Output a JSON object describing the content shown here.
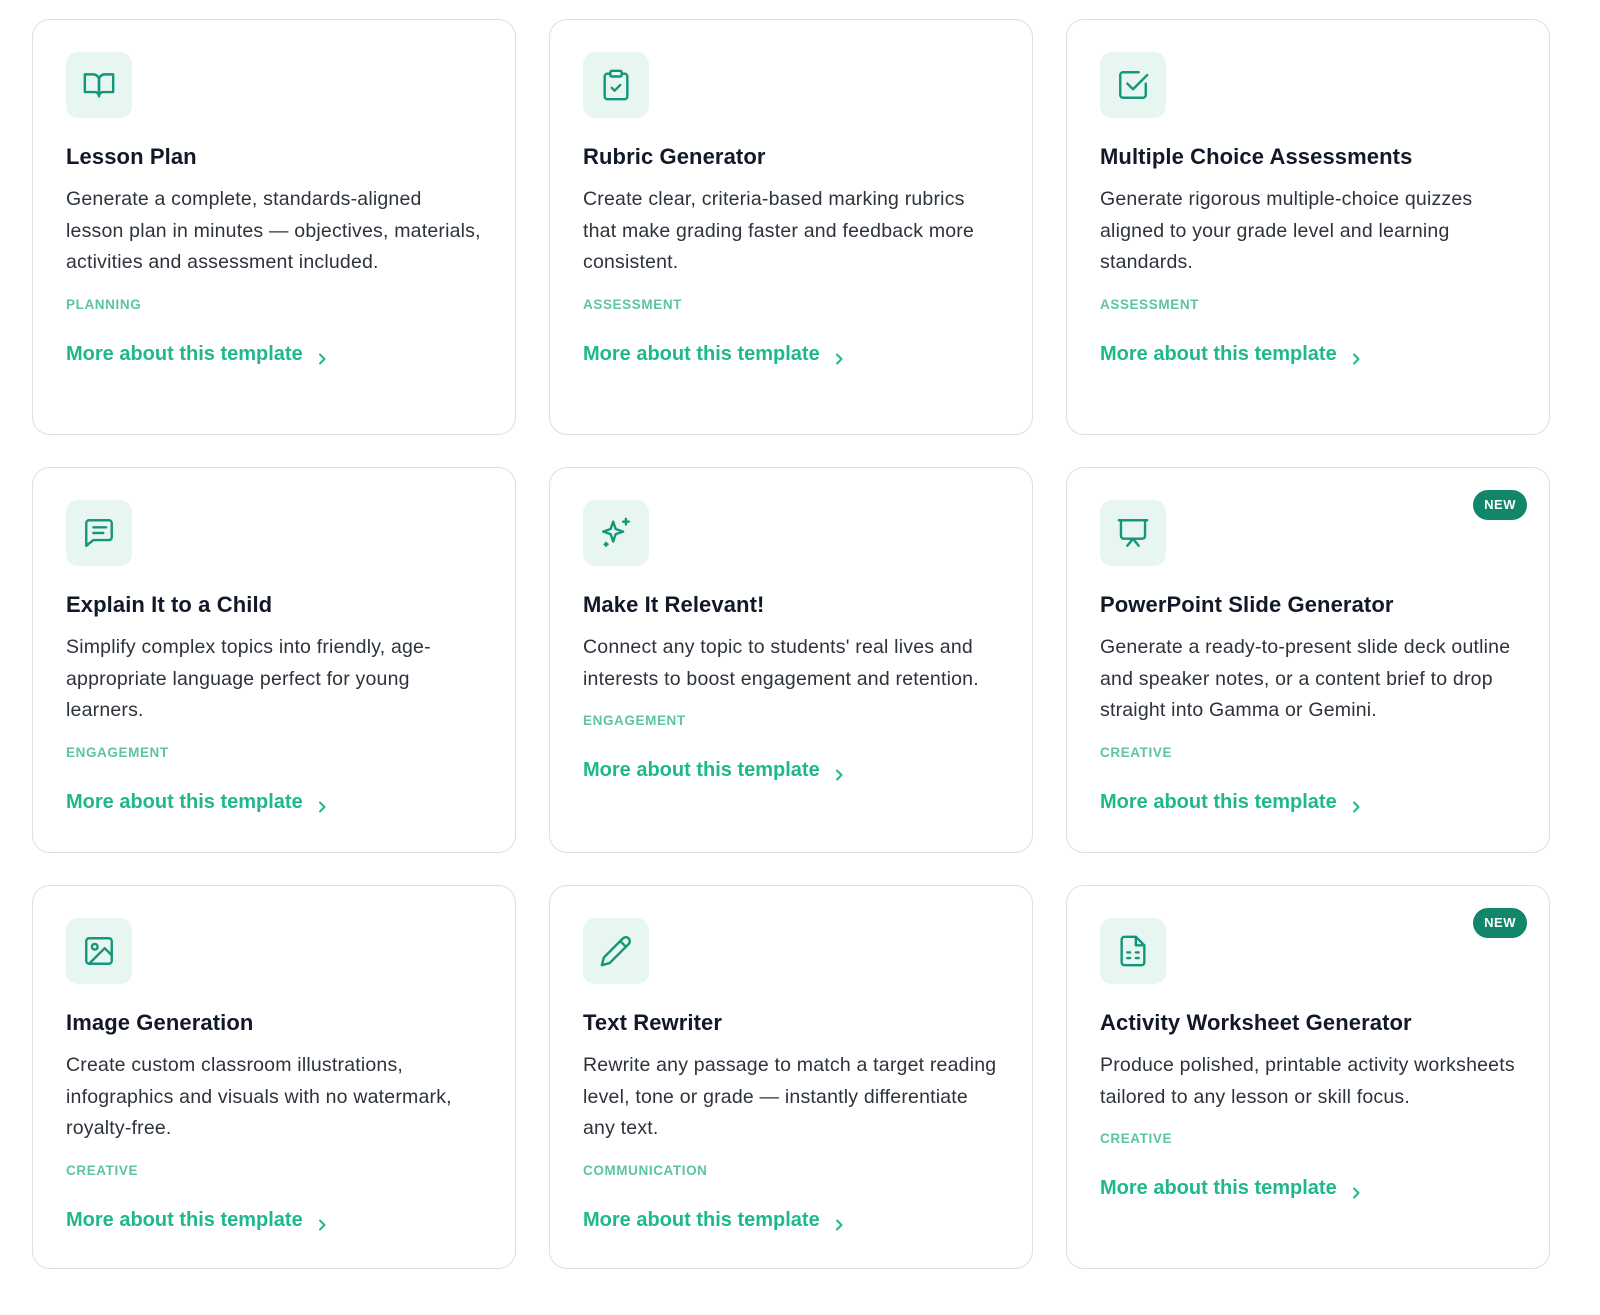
{
  "colors": {
    "accent": "#1fb88d",
    "category": "#5cc4a4",
    "icon_bg": "#e8f6f1",
    "icon_stroke": "#14967a",
    "badge_bg": "#11866b",
    "card_border": "#dcdfe3"
  },
  "cards": [
    {
      "icon": "book-open-icon",
      "title": "Lesson Plan",
      "description": "Generate a complete, standards-aligned lesson plan in minutes — objectives, materials, activities and assessment included.",
      "category": "PLANNING",
      "link_label": "More about this template",
      "badge": ""
    },
    {
      "icon": "clipboard-check-icon",
      "title": "Rubric Generator",
      "description": "Create clear, criteria-based marking rubrics that make grading faster and feedback more consistent.",
      "category": "ASSESSMENT",
      "link_label": "More about this template",
      "badge": ""
    },
    {
      "icon": "square-check-icon",
      "title": "Multiple Choice Assessments",
      "description": "Generate rigorous multiple-choice quizzes aligned to your grade level and learning standards.",
      "category": "ASSESSMENT",
      "link_label": "More about this template",
      "badge": ""
    },
    {
      "icon": "message-text-icon",
      "title": "Explain It to a Child",
      "description": "Simplify complex topics into friendly, age-appropriate language perfect for young learners.",
      "category": "ENGAGEMENT",
      "link_label": "More about this template",
      "badge": ""
    },
    {
      "icon": "sparkles-icon",
      "title": "Make It Relevant!",
      "description": "Connect any topic to students' real lives and interests to boost engagement and retention.",
      "category": "ENGAGEMENT",
      "link_label": "More about this template",
      "badge": ""
    },
    {
      "icon": "presentation-icon",
      "title": "PowerPoint Slide Generator",
      "description": "Generate a ready-to-present slide deck outline and speaker notes, or a content brief to drop straight into Gamma or Gemini.",
      "category": "CREATIVE",
      "link_label": "More about this template",
      "badge": "NEW"
    },
    {
      "icon": "image-icon",
      "title": "Image Generation",
      "description": "Create custom classroom illustrations, infographics and visuals with no watermark, royalty-free.",
      "category": "CREATIVE",
      "link_label": "More about this template",
      "badge": ""
    },
    {
      "icon": "pencil-icon",
      "title": "Text Rewriter",
      "description": "Rewrite any passage to match a target reading level, tone or grade — instantly differentiate any text.",
      "category": "COMMUNICATION",
      "link_label": "More about this template",
      "badge": ""
    },
    {
      "icon": "file-spreadsheet-icon",
      "title": "Activity Worksheet Generator",
      "description": "Produce polished, printable activity worksheets tailored to any lesson or skill focus.",
      "category": "CREATIVE",
      "link_label": "More about this template",
      "badge": "NEW"
    }
  ]
}
